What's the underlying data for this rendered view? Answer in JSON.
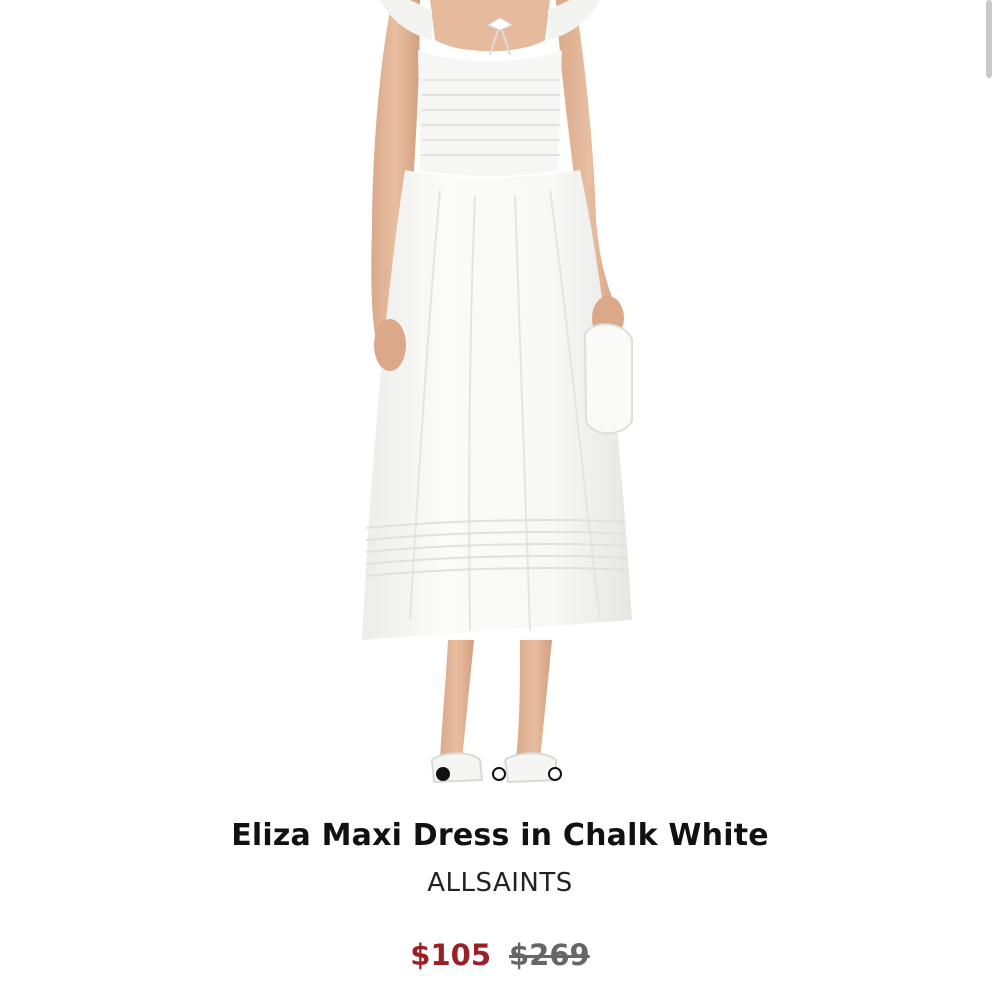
{
  "product": {
    "image_alt": "Model wearing a white smocked maxi dress",
    "title": "Eliza Maxi Dress in Chalk White",
    "brand": "ALLSAINTS",
    "sale_price": "$105",
    "original_price": "$269"
  },
  "carousel": {
    "total": 3,
    "active_index": 0
  },
  "colors": {
    "sale_price": "#9b1f24",
    "original_price": "#666666",
    "title": "#111111"
  }
}
